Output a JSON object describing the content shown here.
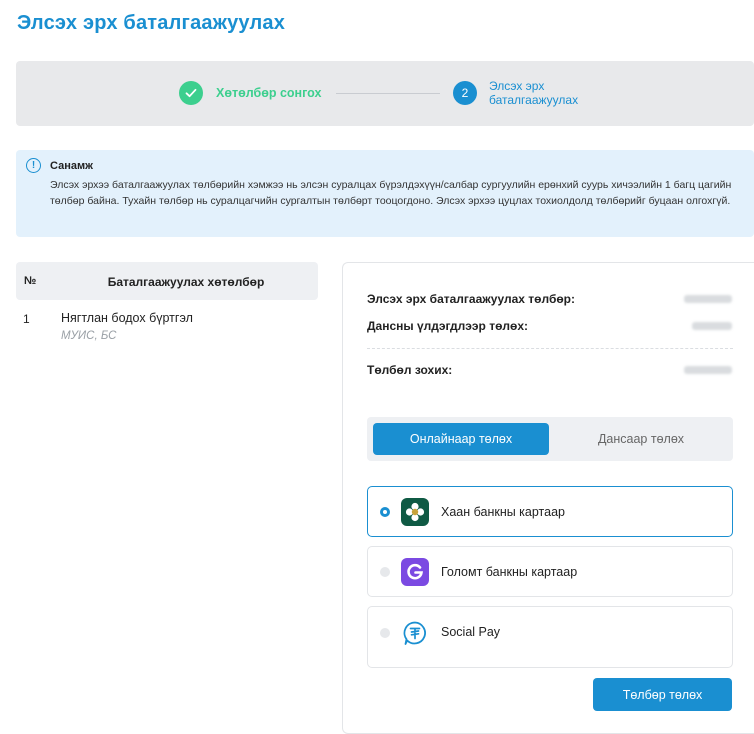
{
  "page": {
    "title": "Элсэх эрх баталгаажуулах"
  },
  "stepper": {
    "steps": [
      {
        "label": "Хөтөлбөр сонгох",
        "status": "done"
      },
      {
        "number": "2",
        "label": "Элсэх эрх баталгаажуулах",
        "status": "active"
      }
    ]
  },
  "notice": {
    "icon": "info-icon",
    "title": "Санамж",
    "text": "Элсэх эрхээ баталгаажуулах төлбөрийн хэмжээ нь  элсэн суралцах бүрэлдэхүүн/салбар сургуулийн ерөнхий суурь хичээлийн 1 багц цагийн төлбөр байна. Тухайн төлбөр нь суралцагчийн сургалтын төлбөрт тооцогдоно. Элсэх эрхээ цуцлах тохиолдолд төлбөрийг буцаан олгохгүй."
  },
  "table": {
    "headers": {
      "no": "№",
      "name": "Баталгаажуулах хөтөлбөр"
    },
    "rows": [
      {
        "no": "1",
        "title": "Нягтлан бодох бүртгэл",
        "subtitle": "МУИС, БС"
      }
    ]
  },
  "payment": {
    "fee_label": "Элсэх эрх баталгаажуулах төлбөр:",
    "balance_label": "Дансны үлдэгдлээр төлөх:",
    "total_label": "Төлбөл зохих:",
    "tabs": {
      "online": "Онлайнаар төлөх",
      "account": "Дансаар төлөх",
      "active": "online"
    },
    "options": [
      {
        "label": "Хаан банкны картаар",
        "icon": "khan-bank-icon",
        "selected": true
      },
      {
        "label": "Голомт банкны картаар",
        "icon": "golomt-bank-icon",
        "selected": false
      },
      {
        "label": "Social Pay",
        "icon": "social-pay-icon",
        "selected": false
      }
    ],
    "submit_label": "Төлбөр төлөх"
  },
  "colors": {
    "accent": "#1a8fd1",
    "success": "#3ccf8e",
    "notice_bg": "#e3f1fc",
    "khan_bank": "#0f5a44",
    "golomt_bank": "#7b4ae2"
  }
}
